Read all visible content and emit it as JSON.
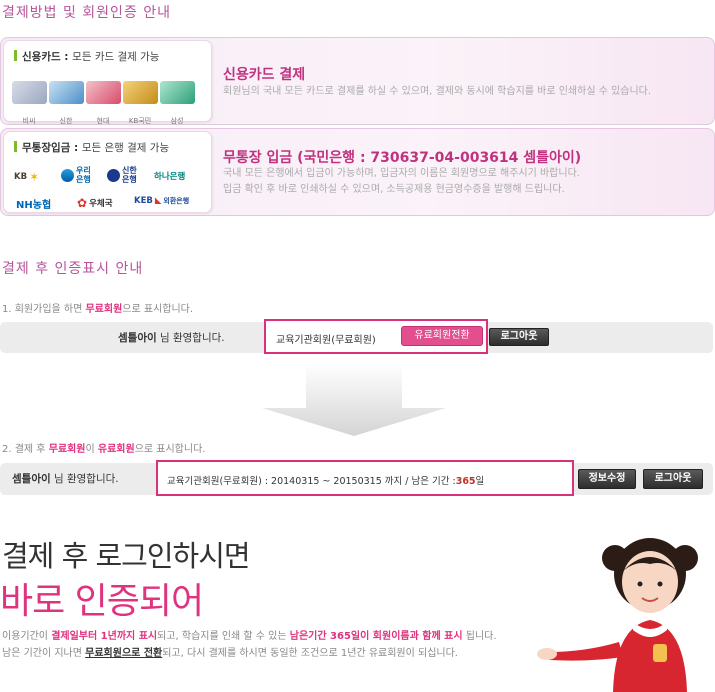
{
  "section1": {
    "title": "결제방법 및 회원인증 안내"
  },
  "credit": {
    "label": "신용카드 :",
    "label_sub": "모든 카드 결제 가능",
    "cards": [
      "비씨",
      "신한",
      "현대",
      "KB국민",
      "삼성"
    ],
    "title": "신용카드 결제",
    "desc": "회원님의 국내 모든 카드로 결제를 하실 수 있으며, 결제와 동시에 학습지를 바로 인쇄하실 수 있습니다."
  },
  "bank": {
    "label": "무통장입금 :",
    "label_sub": "모든 은행 결제 가능",
    "banks": [
      "KB",
      "우리은행",
      "신한은행",
      "하나은행",
      "NH농협",
      "우체국",
      "KEB",
      "외환은행"
    ],
    "title": "무통장 입금 (국민은행 : 730637-04-003614 셈틀아이)",
    "desc1": "국내 모든 은행에서 입금이 가능하며, 입금자의 이름은 회원명으로 해주시기 바랍니다.",
    "desc2": "입금 확인 후 바로 인쇄하실 수 있으며, 소득공제용 현금영수증을 발행해 드립니다."
  },
  "section2": {
    "title": "결제 후 인증표시 안내"
  },
  "step1": {
    "prefix": "1. 회원가입을 하면 ",
    "highlight": "무료회원",
    "suffix": "으로 표시합니다.",
    "user": "셈틀아이",
    "welcome": "님 환영합니다.",
    "status": "교육기관회원(무료회원)",
    "convert_btn": "유료회원전환",
    "logout_btn": "로그아웃"
  },
  "step2": {
    "prefix": "2. 결제 후 ",
    "highlight1": "무료회원",
    "mid": "이 ",
    "highlight2": "유료회원",
    "suffix": "으로 표시합니다.",
    "user": "셈틀아이",
    "welcome": "님 환영합니다.",
    "status": "교육기관회원(무료회원) : 20140315 ~ 20150315 까지 / 남은 기간 :",
    "days": "365",
    "days_unit": "일",
    "info_btn": "정보수정",
    "logout_btn": "로그아웃"
  },
  "promo": {
    "line1": "결제 후 로그인하시면",
    "line2": "바로 인증되어",
    "d1a": "이용기간이 ",
    "d1b": "결제일부터 1년까지 표시",
    "d1c": "되고, 학습지를 인쇄 할 수 있는 ",
    "d1d": "남은기간 365일이 회원이름과 함께 표시",
    "d1e": " 됩니다.",
    "d2a": "남은 기간이 지나면 ",
    "d2b": "무료회원으로 전환",
    "d2c": "되고, 다시 결제를 하시면 동일한 조건으로 1년간 유료회원이 되십니다."
  },
  "colors": {
    "accent": "#e0337f",
    "title_purple": "#b8559a",
    "green_bar": "#7cbb2a"
  }
}
